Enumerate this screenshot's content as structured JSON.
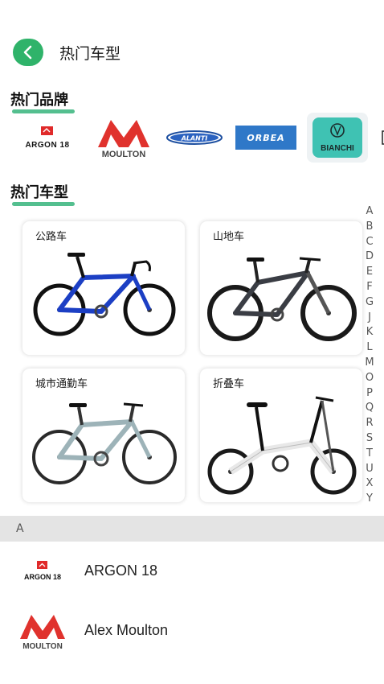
{
  "header": {
    "title": "热门车型"
  },
  "hot_brands": {
    "title": "热门品牌",
    "items": [
      {
        "name": "ARGON 18",
        "logo_text": "ARGON 18"
      },
      {
        "name": "MOULTON",
        "logo_text": "MOULTON"
      },
      {
        "name": "ALANTI",
        "logo_text": "ALANTI"
      },
      {
        "name": "ORBEA",
        "logo_text": "ORBEA"
      },
      {
        "name": "BIANCHI",
        "logo_text": "BIANCHI"
      }
    ]
  },
  "hot_models": {
    "title": "热门车型",
    "cards": [
      {
        "label": "公路车"
      },
      {
        "label": "山地车"
      },
      {
        "label": "城市通勤车"
      },
      {
        "label": "折叠车"
      }
    ]
  },
  "alpha_index": [
    "A",
    "B",
    "C",
    "D",
    "E",
    "F",
    "G",
    "J",
    "K",
    "L",
    "M",
    "O",
    "P",
    "Q",
    "R",
    "S",
    "T",
    "U",
    "X",
    "Y"
  ],
  "brand_list": {
    "section_letter": "A",
    "items": [
      {
        "name": "ARGON 18",
        "logo_text": "ARGON 18"
      },
      {
        "name": "Alex Moulton",
        "logo_text": "MOULTON"
      }
    ]
  },
  "colors": {
    "accent": "#2fb36a",
    "underline": "#36b47b",
    "argon_red": "#e02a2a",
    "moulton_red": "#e0322d",
    "orbea_blue": "#2f78c8",
    "bianchi_teal": "#3fc2b3",
    "road_bike_blue": "#1c3fc4"
  }
}
